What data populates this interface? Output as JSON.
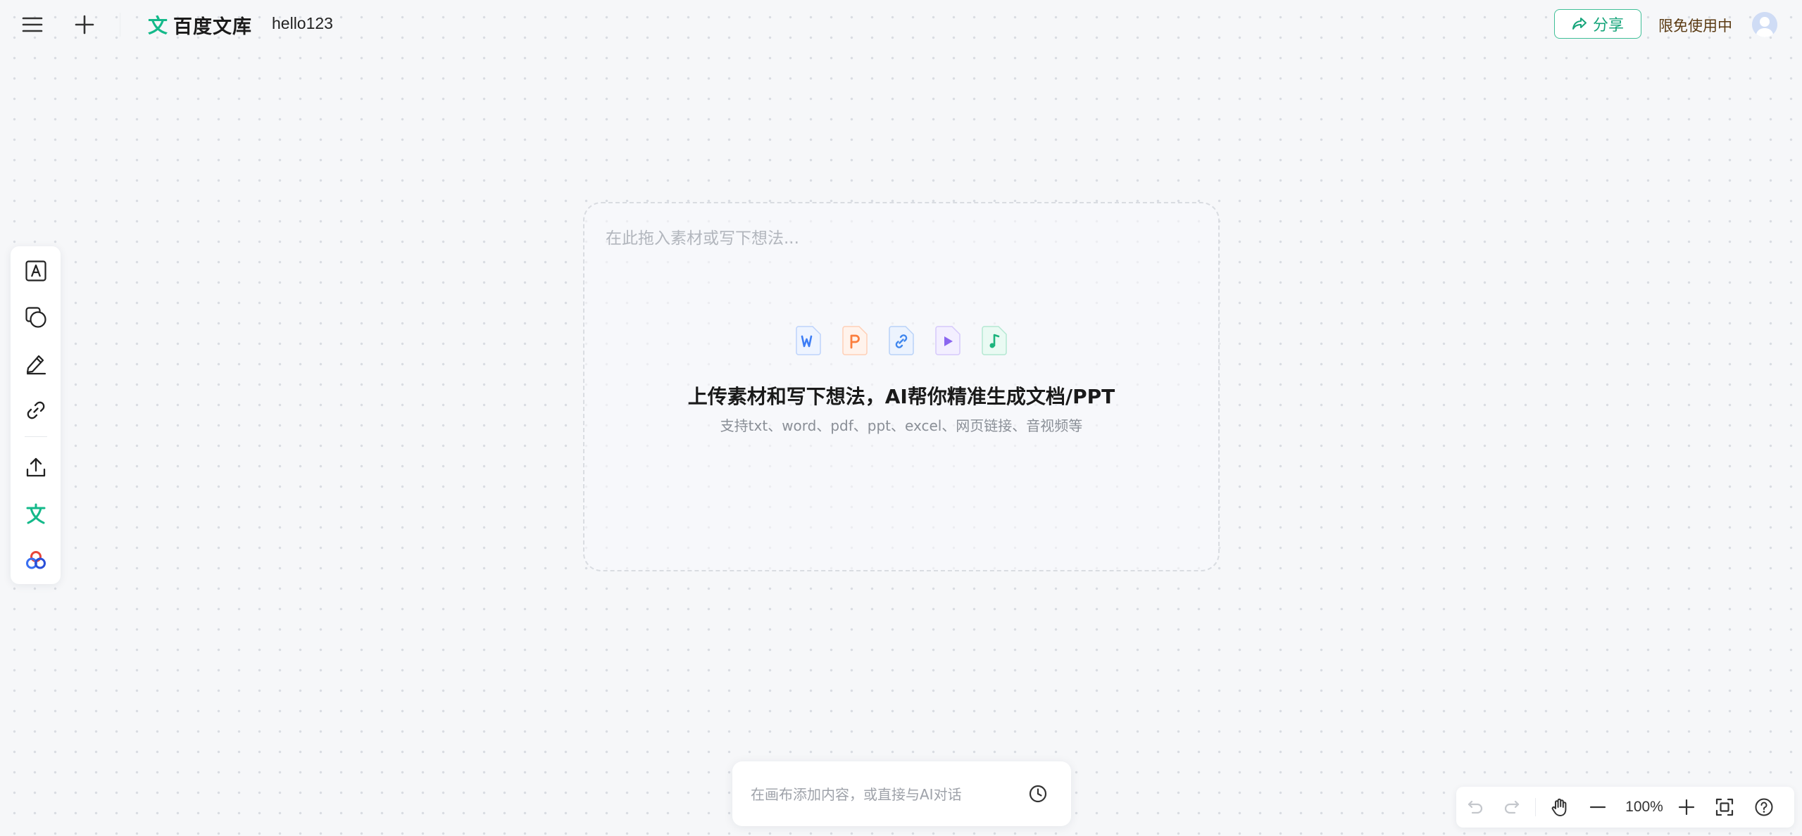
{
  "header": {
    "brand_name": "百度文库",
    "brand_mark": "文",
    "document_title": "hello123",
    "share_label": "分享",
    "free_label": "限免使用中"
  },
  "side_toolbar": {
    "tools": [
      "text-tool",
      "shape-tool",
      "pen-tool",
      "link-tool",
      "upload-tool",
      "wenku-tool",
      "ai-app-tool"
    ]
  },
  "drop_area": {
    "placeholder": "在此拖入素材或写下想法...",
    "file_types": [
      "word",
      "ppt",
      "link",
      "video",
      "audio"
    ],
    "title": "上传素材和写下想法，AI帮你精准生成文档/PPT",
    "subtitle": "支持txt、word、pdf、ppt、excel、网页链接、音视频等"
  },
  "chat": {
    "placeholder": "在画布添加内容，或直接与AI对话"
  },
  "zoom": {
    "level": "100%"
  },
  "colors": {
    "brand": "#14b98a",
    "canvas": "#f6f7f9",
    "share_border": "#3fbf97"
  }
}
